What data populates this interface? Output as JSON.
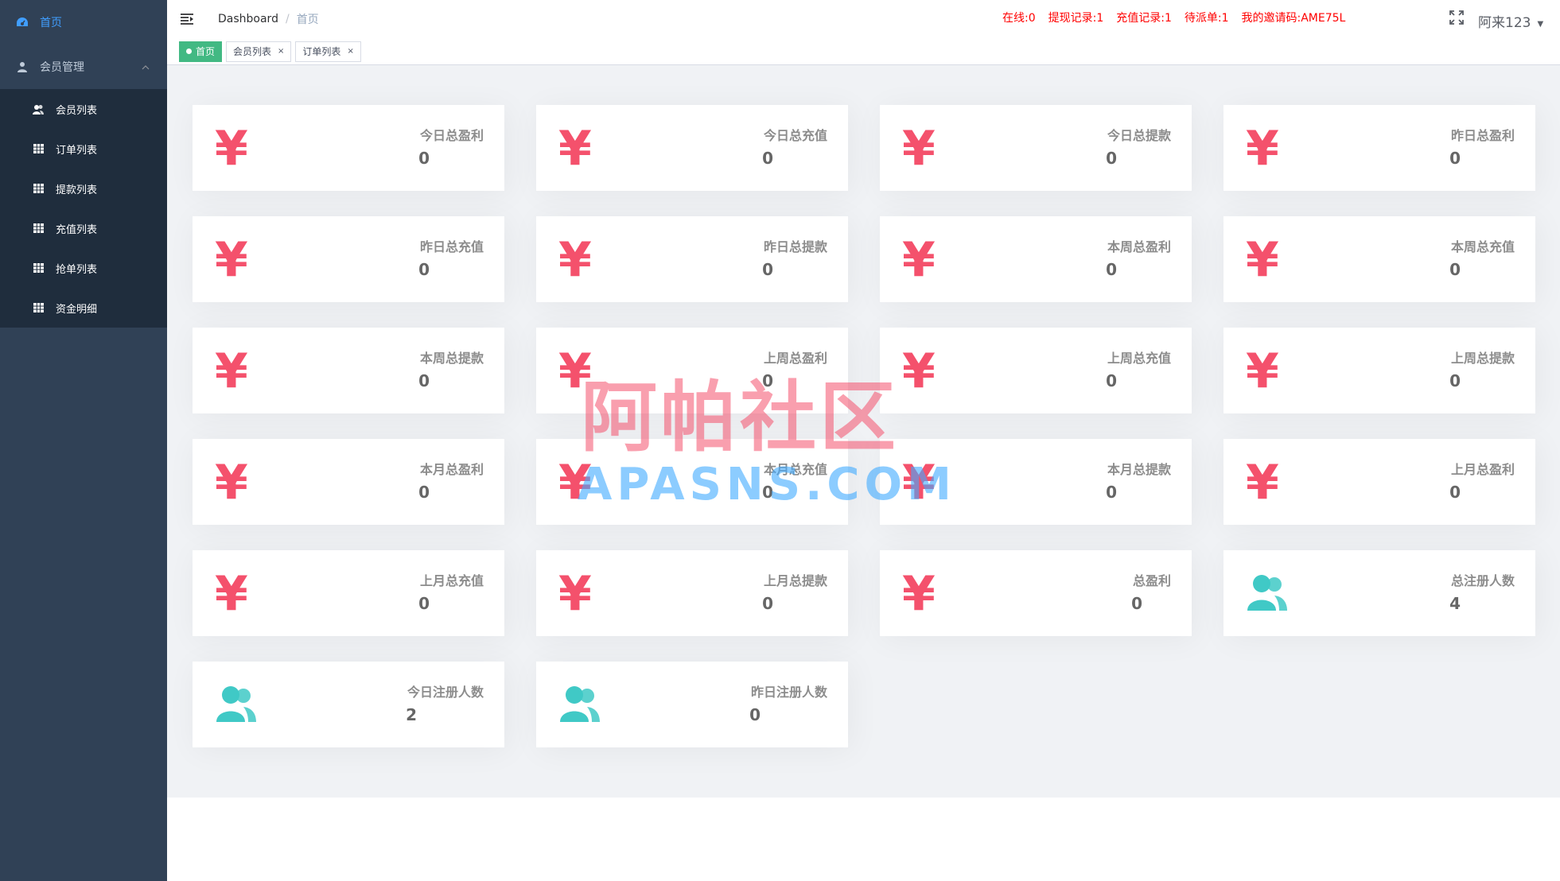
{
  "sidebar": {
    "home_label": "首页",
    "group_label": "会员管理",
    "items": [
      {
        "label": "会员列表"
      },
      {
        "label": "订单列表"
      },
      {
        "label": "提款列表"
      },
      {
        "label": "充值列表"
      },
      {
        "label": "抢单列表"
      },
      {
        "label": "资金明细"
      }
    ]
  },
  "navbar": {
    "breadcrumb": [
      "Dashboard",
      "首页"
    ],
    "status": [
      "在线:0",
      "提现记录:1",
      "充值记录:1",
      "待派单:1",
      "我的邀请码:AME75L"
    ],
    "user_name": "阿来123"
  },
  "tags": [
    {
      "label": "首页",
      "active": true
    },
    {
      "label": "会员列表",
      "active": false
    },
    {
      "label": "订单列表",
      "active": false
    }
  ],
  "cards": [
    {
      "title": "今日总盈利",
      "value": "0",
      "icon": "yen-icon"
    },
    {
      "title": "今日总充值",
      "value": "0",
      "icon": "yen-icon"
    },
    {
      "title": "今日总提款",
      "value": "0",
      "icon": "yen-icon"
    },
    {
      "title": "昨日总盈利",
      "value": "0",
      "icon": "yen-icon"
    },
    {
      "title": "昨日总充值",
      "value": "0",
      "icon": "yen-icon"
    },
    {
      "title": "昨日总提款",
      "value": "0",
      "icon": "yen-icon"
    },
    {
      "title": "本周总盈利",
      "value": "0",
      "icon": "yen-icon"
    },
    {
      "title": "本周总充值",
      "value": "0",
      "icon": "yen-icon"
    },
    {
      "title": "本周总提款",
      "value": "0",
      "icon": "yen-icon"
    },
    {
      "title": "上周总盈利",
      "value": "0",
      "icon": "yen-icon"
    },
    {
      "title": "上周总充值",
      "value": "0",
      "icon": "yen-icon"
    },
    {
      "title": "上周总提款",
      "value": "0",
      "icon": "yen-icon"
    },
    {
      "title": "本月总盈利",
      "value": "0",
      "icon": "yen-icon"
    },
    {
      "title": "本月总充值",
      "value": "0",
      "icon": "yen-icon"
    },
    {
      "title": "本月总提款",
      "value": "0",
      "icon": "yen-icon"
    },
    {
      "title": "上月总盈利",
      "value": "0",
      "icon": "yen-icon"
    },
    {
      "title": "上月总充值",
      "value": "0",
      "icon": "yen-icon"
    },
    {
      "title": "上月总提款",
      "value": "0",
      "icon": "yen-icon"
    },
    {
      "title": "总盈利",
      "value": "0",
      "icon": "yen-icon"
    },
    {
      "title": "总注册人数",
      "value": "4",
      "icon": "people-icon"
    },
    {
      "title": "今日注册人数",
      "value": "2",
      "icon": "people-icon"
    },
    {
      "title": "昨日注册人数",
      "value": "0",
      "icon": "people-icon"
    }
  ],
  "watermark": {
    "cn": "阿帕社区",
    "en": "APASNS.COM"
  },
  "colors": {
    "sidebar_bg": "#304156",
    "submenu_bg": "#1f2d3d",
    "active_menu": "#409eff",
    "yen": "#f4516c",
    "people": "#40c9c6",
    "tag_active": "#42b983",
    "status_red": "#ff0000"
  }
}
